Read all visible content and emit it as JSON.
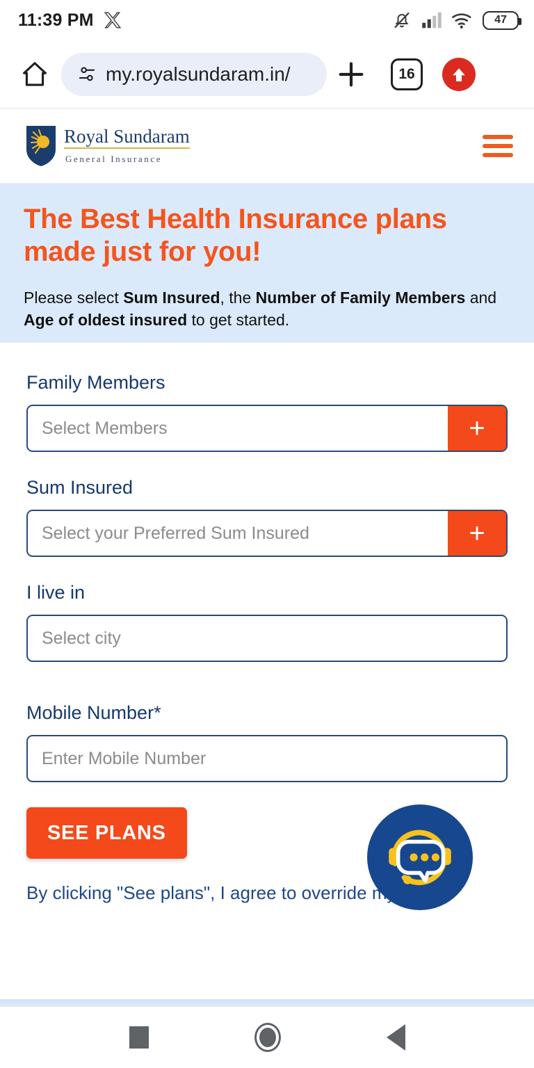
{
  "status_bar": {
    "time": "11:39 PM",
    "app_icon": "x-twitter-icon",
    "icons": [
      "bell-muted-icon",
      "cellular-signal-icon",
      "wifi-icon"
    ],
    "battery_level": "47"
  },
  "browser": {
    "home_icon": "home-icon",
    "site_settings_icon": "tune-icon",
    "url": "my.royalsundaram.in/",
    "new_tab_icon": "plus-icon",
    "tab_count": "16",
    "update_icon": "arrow-up-circle-icon"
  },
  "site_header": {
    "logo_name": "Royal Sundaram",
    "logo_tagline": "General Insurance",
    "menu_icon": "hamburger-menu-icon"
  },
  "hero": {
    "heading": "The Best Health Insurance plans made just for you!",
    "subtext_parts": [
      {
        "text": "Please select ",
        "bold": false
      },
      {
        "text": "Sum Insured",
        "bold": true
      },
      {
        "text": ", the ",
        "bold": false
      },
      {
        "text": "Number of Family Members",
        "bold": true
      },
      {
        "text": " and ",
        "bold": false
      },
      {
        "text": "Age of oldest insured",
        "bold": true
      },
      {
        "text": " to get started.",
        "bold": false
      }
    ]
  },
  "form": {
    "fields": [
      {
        "label": "Family Members",
        "placeholder": "Select Members",
        "value": "",
        "has_add_button": true,
        "add_button_label": "+"
      },
      {
        "label": "Sum Insured",
        "placeholder": "Select your Preferred Sum Insured",
        "value": "",
        "has_add_button": true,
        "add_button_label": "+"
      },
      {
        "label": "I live in",
        "placeholder": "Select city",
        "value": "",
        "has_add_button": false,
        "add_button_label": ""
      },
      {
        "label": "Mobile Number*",
        "placeholder": "Enter Mobile Number",
        "value": "",
        "has_add_button": false,
        "add_button_label": ""
      }
    ],
    "submit_label": "SEE PLANS",
    "disclaimer": "By clicking \"See plans\", I agree to override my DNCR"
  },
  "chat_widget": {
    "icon": "headset-chat-support-icon"
  },
  "nav_bar": {
    "recents_icon": "square-recents-icon",
    "home_icon": "circle-home-icon",
    "back_icon": "triangle-back-icon"
  },
  "colors": {
    "brand_orange": "#f4491a",
    "brand_navy": "#14396d",
    "hero_blue": "#dbeafb",
    "chat_navy": "#17478f",
    "chat_yellow": "#f7c21b"
  }
}
